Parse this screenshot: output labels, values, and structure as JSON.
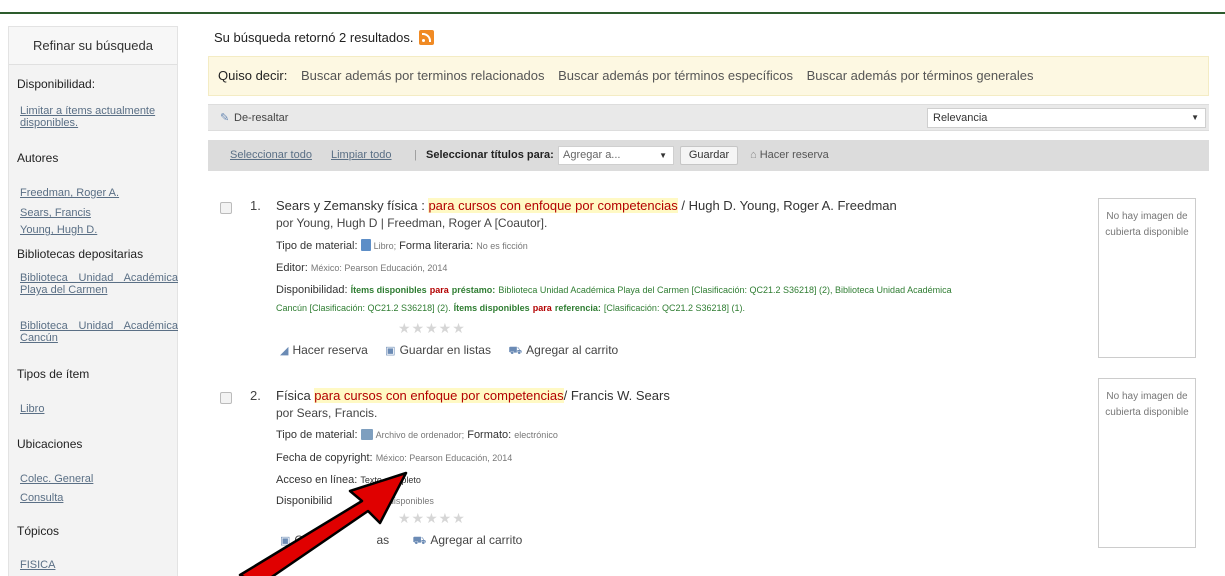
{
  "sidebar": {
    "refine_title": "Refinar su búsqueda",
    "availability_title": "Disponibilidad:",
    "availability_link": "Limitar a ítems actualmente disponibles.",
    "authors_title": "Autores",
    "authors": [
      "Freedman, Roger A.",
      "Sears, Francis",
      "Young, Hugh D."
    ],
    "libraries_title": "Bibliotecas depositarias",
    "libraries": [
      "Biblioteca Unidad Académica Playa del Carmen",
      "Biblioteca Unidad Académica Cancún"
    ],
    "itemtypes_title": "Tipos de ítem",
    "itemtypes": [
      "Libro"
    ],
    "locations_title": "Ubicaciones",
    "locations": [
      "Colec. General",
      "Consulta"
    ],
    "topics_title": "Tópicos",
    "topics": [
      "FISICA"
    ]
  },
  "main": {
    "summary": "Su búsqueda retornó 2 resultados.",
    "didyoumean": {
      "label": "Quiso decir:",
      "suggestions": [
        "Buscar además por terminos relacionados",
        "Buscar además por términos específicos",
        "Buscar además por términos generales"
      ]
    },
    "unhighlight": "De-resaltar",
    "sort_value": "Relevancia",
    "toolbar": {
      "select_all": "Seleccionar todo",
      "clear_all": "Limpiar todo",
      "select_titles_label": "Seleccionar títulos para:",
      "add_to_value": "Agregar a...",
      "save": "Guardar",
      "place_hold": "Hacer reserva"
    }
  },
  "results": [
    {
      "number": "1.",
      "title_pre": "Sears y Zemansky física : ",
      "title_hl": "para cursos con enfoque por competencias",
      "title_post": " / Hugh D. Young, Roger A. Freedman",
      "by": "por Young, Hugh D | Freedman, Roger A [Coautor].",
      "material_label": "Tipo de material:",
      "material_value": "Libro;",
      "form_label": "Forma literaria:",
      "form_value": "No es ficción",
      "publisher_label": "Editor:",
      "publisher_value": "México: Pearson Educación, 2014",
      "avail_label": "Disponibilidad:",
      "avail_items_label": "Ítems disponibles",
      "avail_para": "para",
      "avail_loan": "préstamo:",
      "avail_text1": "Biblioteca Unidad Académica Playa del Carmen [Clasificación: QC21.2 S36218] (2), Biblioteca Unidad Académica",
      "avail_text2_pre": "Cancún [Clasificación: QC21.2 S36218] (2).",
      "avail_ref_label": "Ítems disponibles",
      "avail_ref_para": "para",
      "avail_ref": "referencia:",
      "avail_ref_text": "[Clasificación: QC21.2 S36218] (1).",
      "rating": "★★★★★",
      "actions": [
        "Hacer reserva",
        "Guardar en listas",
        "Agregar al carrito"
      ],
      "cover_text": "No hay imagen de cubierta disponible"
    },
    {
      "number": "2.",
      "title_pre": "Física ",
      "title_hl": "para cursos con enfoque por competencias",
      "title_post": "/ Francis W. Sears",
      "by": "por Sears, Francis.",
      "material_label": "Tipo de material:",
      "material_value": "Archivo de ordenador;",
      "format_label": "Formato:",
      "format_value": "electrónico",
      "copyright_label": "Fecha de copyright:",
      "copyright_value": "México: Pearson Educación, 2014",
      "online_label": "Acceso en línea:",
      "online_value": "Texto completo",
      "avail_label": "Disponibilid",
      "avail_value": "ems disponibles",
      "rating": "★★★★★",
      "actions": [
        "Guar",
        "as",
        "Agregar al carrito"
      ],
      "cover_text": "No hay imagen de cubierta disponible"
    }
  ],
  "colors": {
    "accent_green": "#2d5c2d",
    "highlight_red": "#b30000",
    "arrow_red": "#e00000"
  }
}
